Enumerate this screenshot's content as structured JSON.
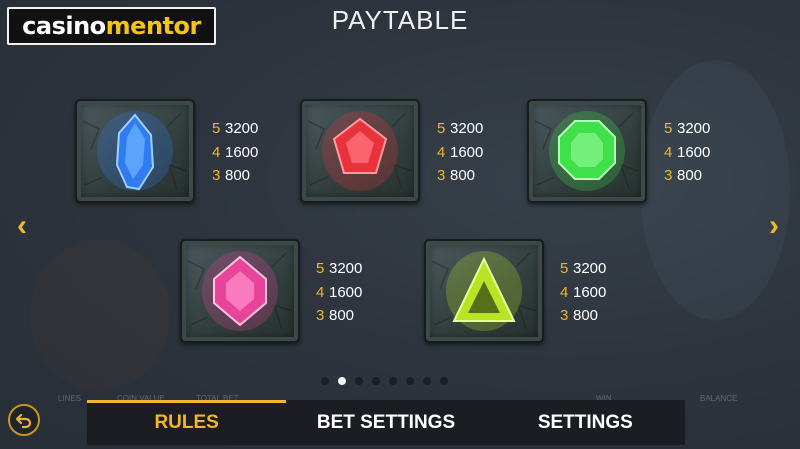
{
  "logo": {
    "part1": "casino",
    "part2": "mentor"
  },
  "title": "PAYTABLE",
  "nav": {
    "prev_icon": "chevron-left-icon",
    "next_icon": "chevron-right-icon"
  },
  "symbols": [
    {
      "name": "blue-gem",
      "color": "#2f7cf0",
      "pays": [
        {
          "count": "5",
          "value": "3200"
        },
        {
          "count": "4",
          "value": "1600"
        },
        {
          "count": "3",
          "value": "800"
        }
      ]
    },
    {
      "name": "red-gem",
      "color": "#e8333d",
      "pays": [
        {
          "count": "5",
          "value": "3200"
        },
        {
          "count": "4",
          "value": "1600"
        },
        {
          "count": "3",
          "value": "800"
        }
      ]
    },
    {
      "name": "green-gem",
      "color": "#3fe04a",
      "pays": [
        {
          "count": "5",
          "value": "3200"
        },
        {
          "count": "4",
          "value": "1600"
        },
        {
          "count": "3",
          "value": "800"
        }
      ]
    },
    {
      "name": "pink-gem",
      "color": "#e8449a",
      "pays": [
        {
          "count": "5",
          "value": "3200"
        },
        {
          "count": "4",
          "value": "1600"
        },
        {
          "count": "3",
          "value": "800"
        }
      ]
    },
    {
      "name": "lime-gem",
      "color": "#b7e526",
      "pays": [
        {
          "count": "5",
          "value": "3200"
        },
        {
          "count": "4",
          "value": "1600"
        },
        {
          "count": "3",
          "value": "800"
        }
      ]
    }
  ],
  "pagination": {
    "total": 8,
    "active_index": 1
  },
  "stats": {
    "lines_label": "LINES",
    "coin_value_label": "COIN VALUE",
    "total_bet_label": "TOTAL BET",
    "win_label": "WIN",
    "balance_label": "BALANCE"
  },
  "back_icon": "back-arrow-icon",
  "tabs": [
    {
      "label": "RULES",
      "active": true
    },
    {
      "label": "BET SETTINGS",
      "active": false
    },
    {
      "label": "SETTINGS",
      "active": false
    }
  ]
}
